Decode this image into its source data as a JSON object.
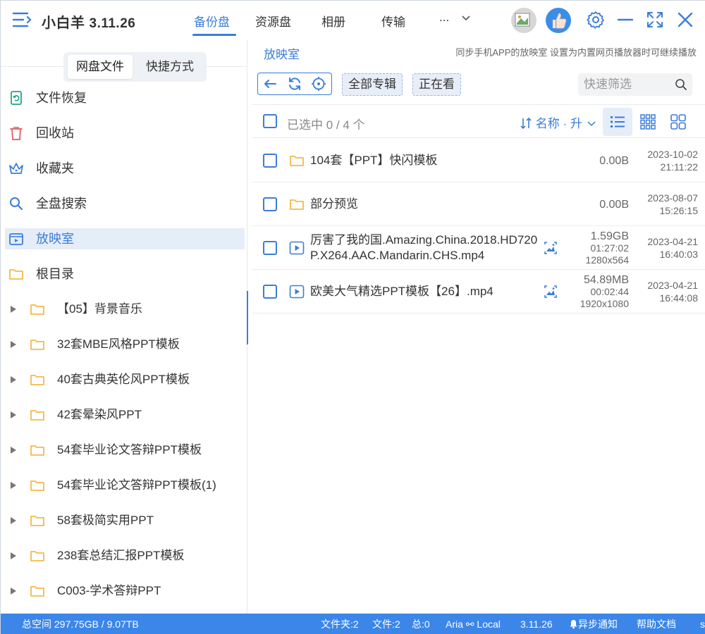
{
  "app": {
    "name": "小白羊",
    "version": "3.11.26"
  },
  "nav": {
    "tabs": [
      {
        "label": "备份盘",
        "active": true
      },
      {
        "label": "资源盘",
        "active": false
      },
      {
        "label": "相册",
        "active": false
      },
      {
        "label": "传输",
        "active": false
      }
    ],
    "more_label": "..."
  },
  "sidebar": {
    "segment": {
      "files": "网盘文件",
      "shortcuts": "快捷方式"
    },
    "items": [
      {
        "label": "文件恢复",
        "icon": "file-restore-icon"
      },
      {
        "label": "回收站",
        "icon": "trash-icon"
      },
      {
        "label": "收藏夹",
        "icon": "crown-icon"
      },
      {
        "label": "全盘搜索",
        "icon": "search-icon"
      },
      {
        "label": "放映室",
        "icon": "video-room-icon",
        "active": true
      },
      {
        "label": "根目录",
        "icon": "folder-icon"
      }
    ],
    "tree": [
      "【05】背景音乐",
      "32套MBE风格PPT模板",
      "40套古典英伦风PPT模板",
      "42套晕染风PPT",
      "54套毕业论文答辩PPT模板",
      "54套毕业论文答辩PPT模板(1)",
      "58套极简实用PPT",
      "238套总结汇报PPT模板",
      "C003-学术答辩PPT"
    ]
  },
  "main": {
    "breadcrumb": "放映室",
    "hint": "同步手机APP的放映室 设置为内置网页播放器时可继续播放",
    "filters": {
      "all_albums": "全部专辑",
      "watching": "正在看"
    },
    "search_placeholder": "快速筛选",
    "selection": "已选中 0 / 4 个",
    "sort_label": "名称 · 升",
    "files": [
      {
        "type": "folder",
        "name": "104套【PPT】快闪模板",
        "size": "0.00B",
        "date": "2023-10-02",
        "time": "21:11:22"
      },
      {
        "type": "folder",
        "name": "部分预览",
        "size": "0.00B",
        "date": "2023-08-07",
        "time": "15:26:15"
      },
      {
        "type": "video",
        "name": "厉害了我的国.Amazing.China.2018.HD720P.X264.AAC.Mandarin.CHS.mp4",
        "size": "1.59GB",
        "duration": "01:27:02",
        "resolution": "1280x564",
        "date": "2023-04-21",
        "time": "16:40:03"
      },
      {
        "type": "video",
        "name": "欧美大气精选PPT模板【26】.mp4",
        "size": "54.89MB",
        "duration": "00:02:44",
        "resolution": "1920x1080",
        "date": "2023-04-21",
        "time": "16:44:08"
      }
    ]
  },
  "status": {
    "space": "总空间 297.75GB / 9.07TB",
    "folders": "文件夹:2",
    "files": "文件:2",
    "total": "总:0",
    "aria": "Aria ⚯ Local",
    "version": "3.11.26",
    "notify": "异步通知",
    "help": "帮助文档",
    "extra": "s"
  },
  "colors": {
    "accent": "#3b7dd8",
    "statusbar": "#3b86e8",
    "folder": "#f5b94a"
  }
}
